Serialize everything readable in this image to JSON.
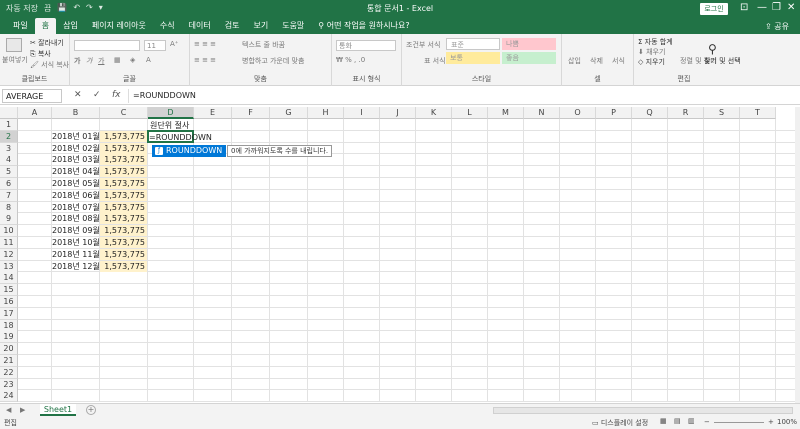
{
  "titlebar": {
    "quick_access": [
      "자동 저장",
      "끔",
      "💾",
      "↶",
      "↷",
      "▾"
    ],
    "title": "통합 문서1 - Excel",
    "login": "로그인",
    "window_controls": [
      "⊡",
      "—",
      "❐",
      "✕"
    ]
  },
  "tabs": [
    "파일",
    "홈",
    "삽입",
    "페이지 레이아웃",
    "수식",
    "데이터",
    "검토",
    "보기",
    "도움말",
    "어떤 작업을 원하시나요?"
  ],
  "share_label": "공유",
  "ribbon": {
    "clipboard": {
      "paste": "붙여넣기",
      "cut": "잘라내기",
      "copy": "복사",
      "format_painter": "서식 복사",
      "label": "클립보드"
    },
    "font": {
      "size": "11",
      "bold": "가",
      "italic": "가",
      "underline": "가",
      "label": "글꼴"
    },
    "alignment": {
      "wrap": "텍스트 줄 바꿈",
      "merge": "병합하고 가운데 맞춤",
      "label": "맞춤"
    },
    "number": {
      "format": "통화",
      "label": "표시 형식"
    },
    "styles": {
      "conditional": "조건부 서식",
      "table": "표 서식",
      "normal": "표준",
      "bad": "나쁨",
      "good": "보통",
      "neutral": "좋음",
      "label": "스타일"
    },
    "cells": {
      "insert": "삽입",
      "delete": "삭제",
      "format": "서식",
      "label": "셀"
    },
    "editing": {
      "autosum": "자동 합계",
      "fill": "채우기",
      "clear": "지우기",
      "sort": "정렬 및 필터",
      "find": "찾기 및 선택",
      "label": "편집"
    }
  },
  "formula_bar": {
    "name_box": "AVERAGE",
    "cancel": "✕",
    "enter": "✓",
    "fx": "fx",
    "content": "=ROUNDDOWN"
  },
  "columns": [
    "A",
    "B",
    "C",
    "D",
    "E",
    "F",
    "G",
    "H",
    "I",
    "J",
    "K",
    "L",
    "M",
    "N",
    "O",
    "P",
    "Q",
    "R",
    "S",
    "T"
  ],
  "rows": [
    "1",
    "2",
    "3",
    "4",
    "5",
    "6",
    "7",
    "8",
    "9",
    "10",
    "11",
    "12",
    "13",
    "14",
    "15",
    "16",
    "17",
    "18",
    "19",
    "20",
    "21",
    "22",
    "23",
    "24"
  ],
  "header_cell": "원단위 절사",
  "active_cell_text": "=ROUNDDOWN",
  "data_rows": [
    {
      "label": "2018년 01월",
      "value": "1,573,775"
    },
    {
      "label": "2018년 02월",
      "value": "1,573,775"
    },
    {
      "label": "2018년 03월",
      "value": "1,573,775"
    },
    {
      "label": "2018년 04월",
      "value": "1,573,775"
    },
    {
      "label": "2018년 05월",
      "value": "1,573,775"
    },
    {
      "label": "2018년 06월",
      "value": "1,573,775"
    },
    {
      "label": "2018년 07월",
      "value": "1,573,775"
    },
    {
      "label": "2018년 08월",
      "value": "1,573,775"
    },
    {
      "label": "2018년 09월",
      "value": "1,573,775"
    },
    {
      "label": "2018년 10월",
      "value": "1,573,775"
    },
    {
      "label": "2018년 11월",
      "value": "1,573,775"
    },
    {
      "label": "2018년 12월",
      "value": "1,573,775"
    }
  ],
  "autocomplete": {
    "item": "ROUNDDOWN",
    "tooltip": "0에 가까워지도록 수를 내립니다."
  },
  "sheet_tab": "Sheet1",
  "add_sheet": "+",
  "status": {
    "mode": "편집",
    "display_settings": "디스플레이 설정",
    "zoom": "100%"
  },
  "colors": {
    "excel_green": "#217346",
    "highlight": "#fff2cc",
    "autocomplete_blue": "#0078d7"
  }
}
